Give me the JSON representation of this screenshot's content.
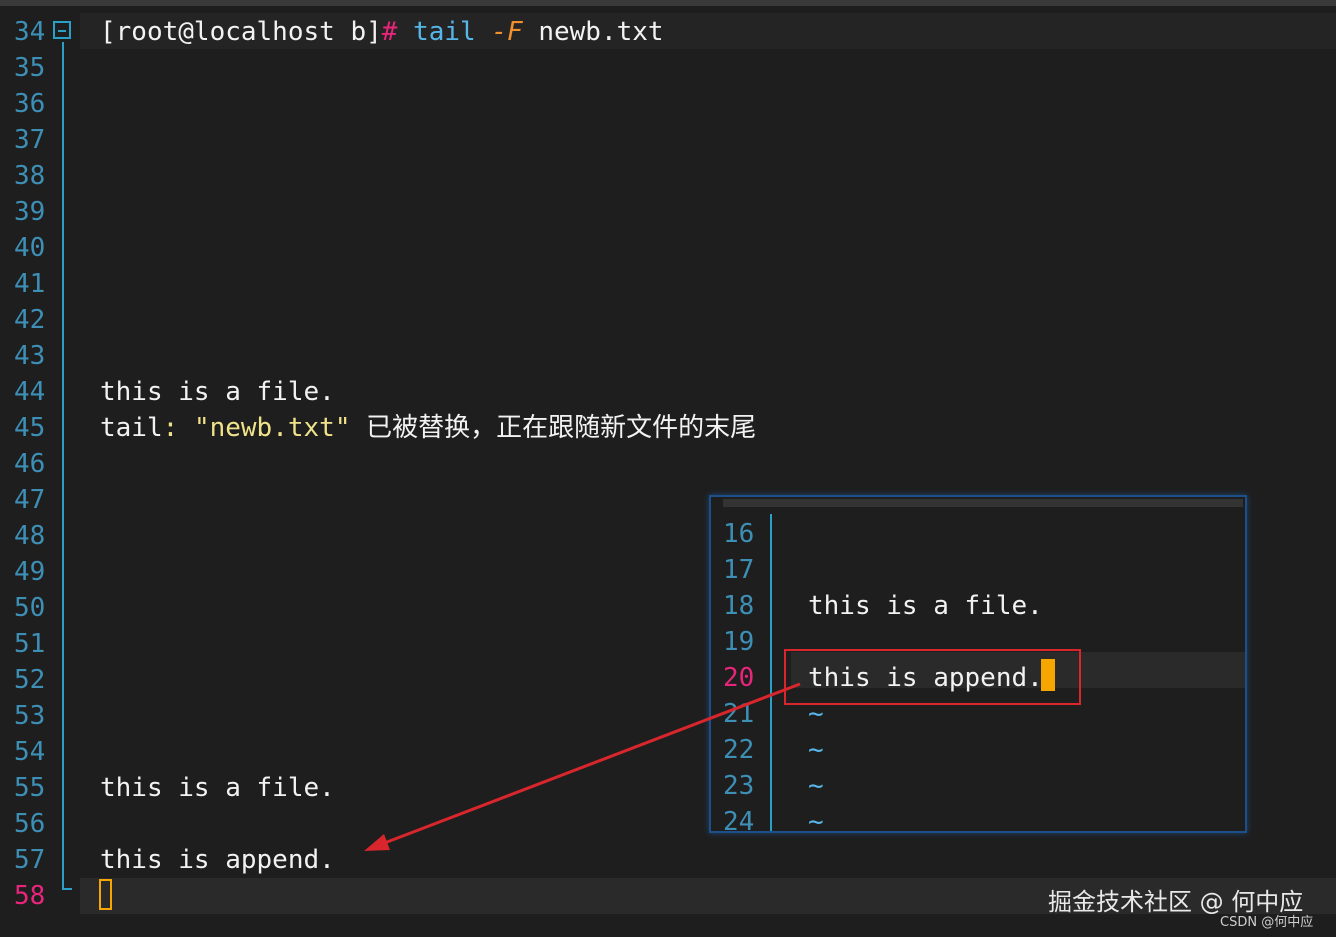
{
  "editor": {
    "line_numbers": [
      "34",
      "35",
      "36",
      "37",
      "38",
      "39",
      "40",
      "41",
      "42",
      "43",
      "44",
      "45",
      "46",
      "47",
      "48",
      "49",
      "50",
      "51",
      "52",
      "53",
      "54",
      "55",
      "56",
      "57",
      "58"
    ],
    "current_line": "58",
    "prompt": {
      "user_host": "[root@localhost b]",
      "hash": "#",
      "command": "tail",
      "flag": "-F",
      "argument": "newb.txt"
    },
    "line44": "this is a file.",
    "line45": {
      "prefix": "tail",
      "colon": ":",
      "quoted": "\"newb.txt\"",
      "message": "已被替换，正在跟随新文件的末尾"
    },
    "line55": "this is a file.",
    "line57": "this is append."
  },
  "popup": {
    "line_numbers": [
      "16",
      "17",
      "18",
      "19",
      "20",
      "21",
      "22",
      "23",
      "24"
    ],
    "current_line": "20",
    "line18": "this is a file.",
    "line20": "this is append.",
    "tilde": "~"
  },
  "annotation": {
    "box_color": "#d9262c",
    "arrow_color": "#d9262c"
  },
  "watermark": {
    "main": "掘金技术社区 @ 何中应",
    "sub": "CSDN @何中应"
  },
  "colors": {
    "background": "#1e1e1e",
    "line_number": "#3d8fb5",
    "current_line_number": "#e8257a",
    "command": "#56b6e8",
    "flag": "#f0902c",
    "string": "#f0e28a",
    "cursor": "#f5a700"
  }
}
